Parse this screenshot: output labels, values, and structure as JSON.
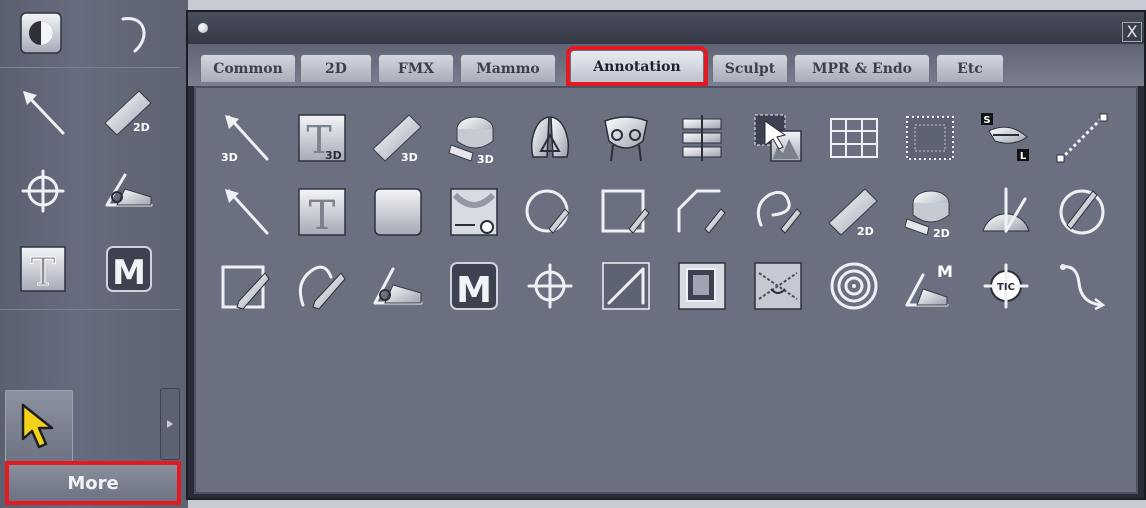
{
  "left_toolbar": {
    "top_icons": [
      "half-circle-icon",
      "undo-icon"
    ],
    "tools": [
      {
        "icon": "arrow-icon",
        "label": ""
      },
      {
        "icon": "ruler-icon",
        "label": "2D"
      },
      {
        "icon": "crosshair-icon",
        "label": ""
      },
      {
        "icon": "angle-icon",
        "label": ""
      },
      {
        "icon": "text-icon",
        "label": "T"
      },
      {
        "icon": "marker-icon",
        "label": "M"
      }
    ],
    "more_label": "More"
  },
  "panel": {
    "close_label": "X",
    "tabs": [
      {
        "label": "Common",
        "active": false
      },
      {
        "label": "2D",
        "active": false
      },
      {
        "label": "FMX",
        "active": false
      },
      {
        "label": "Mammo",
        "active": false
      },
      {
        "label": "Annotation",
        "active": true
      },
      {
        "label": "Sculpt",
        "active": false
      },
      {
        "label": "MPR & Endo",
        "active": false
      },
      {
        "label": "Etc",
        "active": false
      }
    ],
    "icon_rows": [
      [
        {
          "icon": "arrow-3d-icon",
          "badge": "3D"
        },
        {
          "icon": "text-3d-icon",
          "badge": "3D",
          "glyph": "T"
        },
        {
          "icon": "ruler-3d-icon",
          "badge": "3D"
        },
        {
          "icon": "tape-measure-3d-icon",
          "badge": "3D"
        },
        {
          "icon": "lung-icon",
          "badge": ""
        },
        {
          "icon": "pelvis-icon",
          "badge": ""
        },
        {
          "icon": "spine-icon",
          "badge": ""
        },
        {
          "icon": "profile-overlay-icon",
          "badge": ""
        },
        {
          "icon": "grid-table-icon",
          "badge": ""
        },
        {
          "icon": "dotted-frame-icon",
          "badge": ""
        },
        {
          "icon": "spine-sl-icon",
          "badge": "S L"
        },
        {
          "icon": "dotted-line-icon",
          "badge": ""
        }
      ],
      [
        {
          "icon": "arrow-icon",
          "badge": ""
        },
        {
          "icon": "text-icon",
          "badge": "",
          "glyph": "T"
        },
        {
          "icon": "blank-tile-icon",
          "badge": ""
        },
        {
          "icon": "xray-measure-icon",
          "badge": ""
        },
        {
          "icon": "ellipse-pen-icon",
          "badge": ""
        },
        {
          "icon": "rectangle-pen-icon",
          "badge": ""
        },
        {
          "icon": "polygon-pen-icon",
          "badge": ""
        },
        {
          "icon": "freehand-pen-icon",
          "badge": ""
        },
        {
          "icon": "ruler-2d-icon",
          "badge": "2D"
        },
        {
          "icon": "tape-measure-2d-icon",
          "badge": "2D"
        },
        {
          "icon": "protractor-icon",
          "badge": ""
        },
        {
          "icon": "circle-pen-icon",
          "badge": ""
        }
      ],
      [
        {
          "icon": "square-pencil-icon",
          "badge": ""
        },
        {
          "icon": "freehand-pencil-icon",
          "badge": ""
        },
        {
          "icon": "angle-icon",
          "badge": ""
        },
        {
          "icon": "marker-m-icon",
          "badge": "",
          "glyph": "M"
        },
        {
          "icon": "crosshair-icon",
          "badge": ""
        },
        {
          "icon": "line-box-icon",
          "badge": ""
        },
        {
          "icon": "layered-frame-icon",
          "badge": ""
        },
        {
          "icon": "cobb-angle-icon",
          "badge": ""
        },
        {
          "icon": "concentric-circles-icon",
          "badge": ""
        },
        {
          "icon": "angle-m-icon",
          "badge": "M"
        },
        {
          "icon": "tic-target-icon",
          "badge": "TIC"
        },
        {
          "icon": "curve-icon",
          "badge": ""
        }
      ]
    ]
  },
  "colors": {
    "highlight": "#e41a23",
    "panel_bg": "#6b7080",
    "pointer": "#f5d21a"
  }
}
